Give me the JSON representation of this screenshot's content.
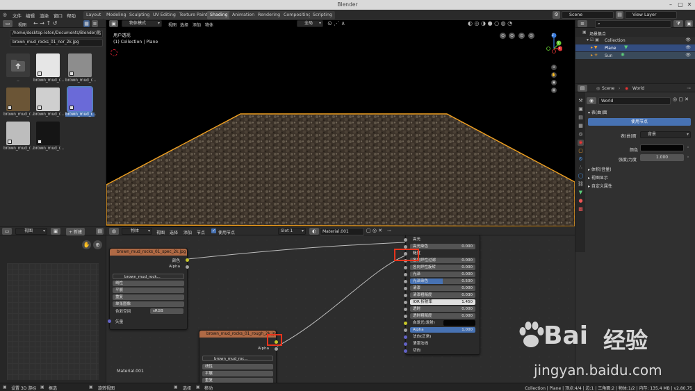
{
  "window": {
    "title": "Blender"
  },
  "menu": [
    "文件",
    "编辑",
    "渲染",
    "窗口",
    "帮助"
  ],
  "workspaces": [
    "Layout",
    "Modeling",
    "Sculpting",
    "UV Editing",
    "Texture Paint",
    "Shading",
    "Animation",
    "Rendering",
    "Compositing",
    "Scripting"
  ],
  "active_workspace": "Shading",
  "scene_field": "Scene",
  "view_layer_field": "View Layer",
  "file_browser": {
    "view_label": "视图",
    "path": "/home/desktop-leton/Documents/Blender/贴图/...",
    "filename": "brown_mud_rocks_01_nor_2k.jpg",
    "parent_label": "..",
    "thumbs": [
      {
        "label": "brown_mud_r...",
        "color": "#e6e6e6"
      },
      {
        "label": "brown_mud_r...",
        "color": "#8d8d8d"
      },
      {
        "label": "brown_mud_r...",
        "color": "#6b5536"
      },
      {
        "label": "brown_mud_r...",
        "color": "#cfcfcf"
      },
      {
        "label": "brown_mud_r...",
        "color": "#6a6ad8"
      },
      {
        "label": "brown_mud_r...",
        "color": "#bdbdbd"
      },
      {
        "label": "brown_mud_r...",
        "color": "#151515"
      }
    ]
  },
  "image_editor": {
    "view_label": "视图",
    "new_label": "新建"
  },
  "viewport": {
    "mode": "物体模式",
    "menu": [
      "视图",
      "选择",
      "添加",
      "物体"
    ],
    "shading_label": "全局",
    "overlay_line1": "用户透视",
    "overlay_line2": "(1) Collection | Plane",
    "axis_x": "X",
    "axis_y": "Y",
    "axis_z": "Z"
  },
  "node_editor": {
    "editor_type": "物体",
    "menu": [
      "视图",
      "选择",
      "添加",
      "节点"
    ],
    "use_nodes": "使用节点",
    "slot": "Slot 1",
    "material": "Material.001",
    "material_label": "Material.001",
    "node1": {
      "title": "brown_mud_rocks_01_spec_2k.jpg",
      "out_color": "颜色",
      "out_alpha": "Alpha",
      "image": "brown_mud_rock...",
      "interp": "线性",
      "proj": "平展",
      "ext": "重复",
      "source": "单张图像",
      "cs_label": "色彩空间",
      "cs_value": "sRGB",
      "vector": "矢量"
    },
    "node2": {
      "title": "brown_mud_rocks_01_rough_2k.jpg",
      "out_alpha": "Alpha",
      "image": "brown_mud_roc...",
      "interp": "线性",
      "proj": "平展",
      "ext": "重复"
    },
    "bsdf": [
      {
        "label": "高光",
        "value": ""
      },
      {
        "label": "高光染色",
        "value": "0.000"
      },
      {
        "label": "糙度",
        "value": ""
      },
      {
        "label": "各向异性过滤",
        "value": "0.000"
      },
      {
        "label": "各向异性旋转",
        "value": "0.000"
      },
      {
        "label": "光泽",
        "value": "0.000"
      },
      {
        "label": "光泽染色",
        "value": "0.500"
      },
      {
        "label": "清漆",
        "value": "0.000"
      },
      {
        "label": "清漆粗糙度",
        "value": "0.030"
      },
      {
        "label": "IOR 折射率",
        "value": "1.450"
      },
      {
        "label": "透射",
        "value": "0.000"
      },
      {
        "label": "透射粗糙度",
        "value": "0.000"
      },
      {
        "label": "自发光(发射)",
        "value": ""
      },
      {
        "label": "Alpha",
        "value": "1.000"
      },
      {
        "label": "法向(正常)",
        "value": ""
      },
      {
        "label": "清漆法线",
        "value": ""
      },
      {
        "label": "切向",
        "value": ""
      }
    ]
  },
  "outliner": {
    "root": "场景集合",
    "collection": "Collection",
    "plane": "Plane",
    "sun": "Sun"
  },
  "properties": {
    "scene": "Scene",
    "world": "World",
    "world_field": "World",
    "surface": "表(曲)面",
    "use_nodes": "使用节点",
    "surface_label": "表(曲)面",
    "surface_value": "背景",
    "color_label": "颜色",
    "strength_label": "强度/力度",
    "strength_value": "1.000",
    "sections": [
      "体积(音量)",
      "视图显示",
      "自定义属性"
    ]
  },
  "statusbar": {
    "left1": "设置 3D 游标",
    "left2": "框选",
    "left3": "旋转视图",
    "mid1": "选择",
    "mid2": "移动",
    "right": "Collection | Plane | 顶点:4/4 | 边:1 | 三角面:2 | 物体:1/2 | 内存: 135.4 MB | v2.80.75"
  },
  "watermark": {
    "brand": "Bai",
    "brand2": "经验",
    "url": "jingyan.baidu.com"
  }
}
